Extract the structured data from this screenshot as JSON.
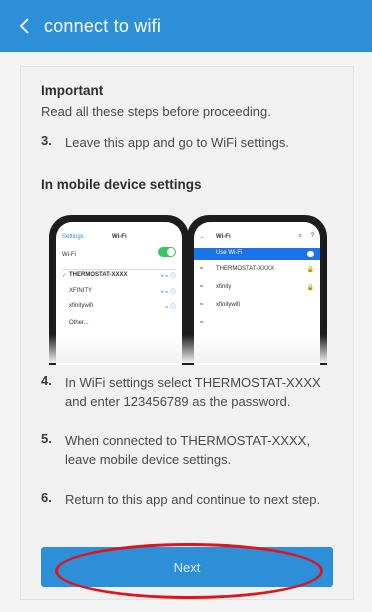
{
  "header": {
    "title": "connect to wifi"
  },
  "content": {
    "important": "Important",
    "intro": "Read all these steps before proceeding.",
    "steps": [
      {
        "num": "3.",
        "text": "Leave this app and go to WiFi settings."
      },
      {
        "num": "4.",
        "text": "In WiFi settings select THERMOSTAT-XXXX and enter 123456789 as the password."
      },
      {
        "num": "5.",
        "text": "When connected to THERMOSTAT-XXXX, leave mobile device settings."
      },
      {
        "num": "6.",
        "text": "Return to this app and continue to next step."
      }
    ],
    "section_title": "In mobile device settings"
  },
  "ios_phone": {
    "back": "Settings",
    "title": "Wi-Fi",
    "wifi_label": "Wi-Fi",
    "networks": [
      "THERMOSTAT-XXXX",
      "XFINITY",
      "xfinitywifi",
      "Other..."
    ]
  },
  "android_phone": {
    "title": "Wi-Fi",
    "use_wifi": "Use Wi-Fi",
    "networks": [
      "THERMOSTAT-XXXX",
      "xfinity",
      "xfinitywifi"
    ]
  },
  "next_button": {
    "label": "Next"
  },
  "colors": {
    "accent": "#2c8fd8",
    "annotation": "#e0141d"
  }
}
